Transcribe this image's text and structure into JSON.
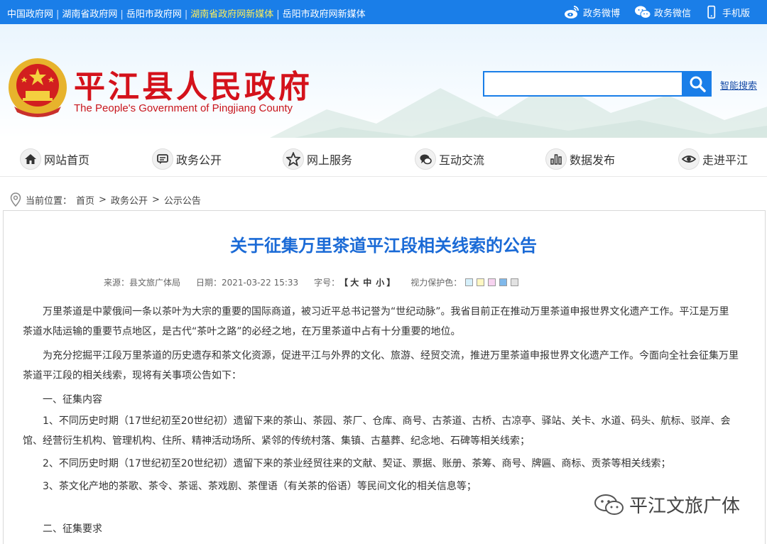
{
  "topbar": {
    "links": [
      "中国政府网",
      "湖南省政府网",
      "岳阳市政府网",
      "湖南省政府网新媒体",
      "岳阳市政府网新媒体"
    ],
    "separator": "|",
    "right": [
      {
        "icon": "weibo-icon",
        "label": "政务微博"
      },
      {
        "icon": "wechat-icon",
        "label": "政务微信"
      },
      {
        "icon": "mobile-icon",
        "label": "手机版"
      }
    ],
    "colors": {
      "bar": "#1a7ee8",
      "highlight": "#ffef5a"
    }
  },
  "header": {
    "title": "平江县人民政府",
    "subtitle": "The People's Government of Pingjiang County",
    "search_placeholder": "",
    "smart_search": "智能搜索",
    "colors": {
      "title": "#d4121b"
    }
  },
  "nav": [
    {
      "icon": "home-icon",
      "label": "网站首页"
    },
    {
      "icon": "chat-icon",
      "label": "政务公开"
    },
    {
      "icon": "star-icon",
      "label": "网上服务"
    },
    {
      "icon": "comment-icon",
      "label": "互动交流"
    },
    {
      "icon": "bar-chart-icon",
      "label": "数据发布"
    },
    {
      "icon": "eye-icon",
      "label": "走进平江"
    }
  ],
  "breadcrumb": {
    "label": "当前位置：",
    "items": [
      "首页",
      "政务公开",
      "公示公告"
    ],
    "sep": ">"
  },
  "article": {
    "title": "关于征集万里茶道平江段相关线索的公告",
    "meta": {
      "source": "来源：县文旅广体局",
      "date": "日期：2021-03-22 15:33",
      "size_label": "字号：",
      "size_open": "【",
      "size_big": "大",
      "size_mid": "中",
      "size_small": "小",
      "size_close": "】",
      "eye_label": "视力保护色：",
      "swatches": [
        "#d6f0fb",
        "#fff7c2",
        "#f7d3f0",
        "#7fb8ea",
        "#e2e2e2"
      ]
    },
    "paragraphs": [
      "万里茶道是中蒙俄间一条以茶叶为大宗的重要的国际商道，被习近平总书记誉为“世纪动脉”。我省目前正在推动万里茶道申报世界文化遗产工作。平江是万里",
      "茶道水陆运输的重要节点地区，是古代“茶叶之路”的必经之地，在万里茶道中占有十分重要的地位。",
      "为充分挖掘平江段万里茶道的历史遗存和茶文化资源，促进平江与外界的文化、旅游、经贸交流，推进万里茶道申报世界文化遗产工作。今面向全社会征集万里",
      "茶道平江段的相关线索，现将有关事项公告如下：",
      "一、征集内容",
      "1、不同历史时期（17世纪初至20世纪初）遗留下来的茶山、茶园、茶厂、仓库、商号、古茶道、古桥、古凉亭、驿站、关卡、水道、码头、航标、驳岸、会",
      "馆、经营衍生机构、管理机构、住所、精神活动场所、紧邻的传统村落、集镇、古墓葬、纪念地、石碑等相关线索；",
      "2、不同历史时期（17世纪初至20世纪初）遗留下来的茶业经贸往来的文献、契证、票据、账册、茶筹、商号、牌匾、商标、贡茶等相关线索；",
      "3、茶文化产地的茶歌、茶令、茶谣、茶戏剧、茶俚语（有关茶的俗语）等民间文化的相关信息等；",
      "二、征集要求"
    ]
  },
  "watermark": {
    "icon": "wechat-icon",
    "text": "平江文旅广体"
  }
}
